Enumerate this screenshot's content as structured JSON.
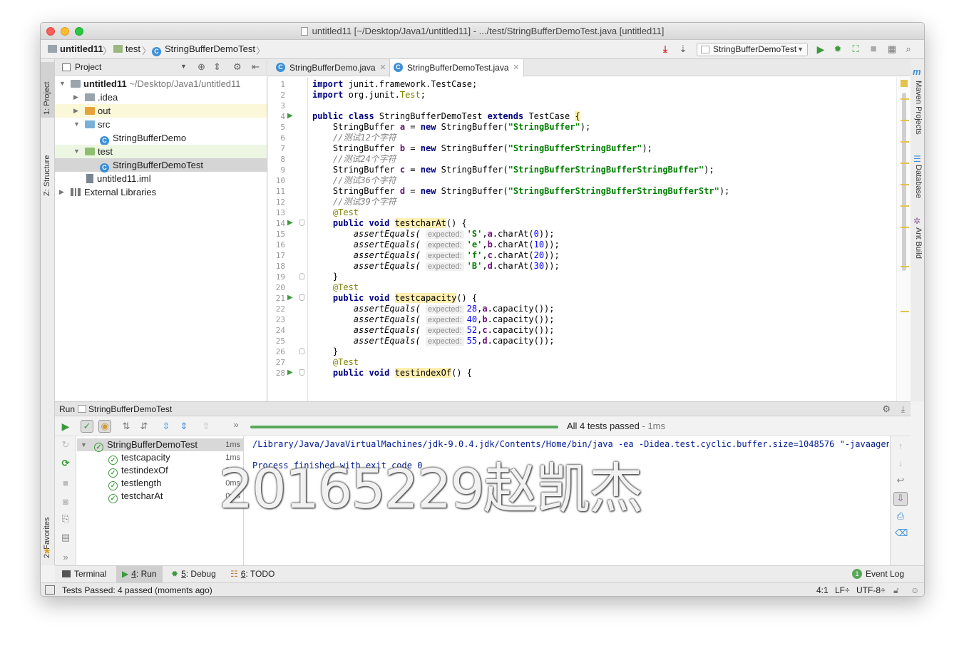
{
  "window": {
    "title": "untitled11 [~/Desktop/Java1/untitled11] - .../test/StringBufferDemoTest.java [untitled11]"
  },
  "breadcrumb": [
    "untitled11",
    "test",
    "StringBufferDemoTest"
  ],
  "toolbar": {
    "run_config": "StringBufferDemoTest"
  },
  "left_strip": {
    "project": "1: Project",
    "structure": "Z: Structure",
    "favorites": "2: Favorites"
  },
  "right_strip": {
    "maven": "Maven Projects",
    "database": "Database",
    "ant": "Ant Build"
  },
  "project_panel": {
    "title": "Project",
    "tree": [
      {
        "label": "untitled11",
        "extra": "~/Desktop/Java1/untitled11"
      },
      {
        "label": ".idea"
      },
      {
        "label": "out"
      },
      {
        "label": "src"
      },
      {
        "label": "StringBufferDemo"
      },
      {
        "label": "test"
      },
      {
        "label": "StringBufferDemoTest"
      },
      {
        "label": "untitled11.iml"
      },
      {
        "label": "External Libraries"
      }
    ]
  },
  "editor": {
    "tabs": [
      {
        "label": "StringBufferDemo.java",
        "active": false
      },
      {
        "label": "StringBufferDemoTest.java",
        "active": true
      }
    ],
    "hint": "expected:",
    "lines": {
      "l1a": "import",
      "l1b": " junit.framework.TestCase;",
      "l2a": "import",
      "l2b": " org.junit.",
      "l2c": "Test",
      "l2d": ";",
      "l4a": "public class",
      "l4b": " StringBufferDemoTest ",
      "l4c": "extends",
      "l4d": " TestCase ",
      "l4e": "{",
      "l5a": "    StringBuffer ",
      "l5b": "a",
      "l5c": " = ",
      "l5d": "new",
      "l5e": " StringBuffer(",
      "l5f": "\"StringBuffer\"",
      "l5g": ");",
      "l6": "    //测试12个字符",
      "l7a": "    StringBuffer ",
      "l7b": "b",
      "l7c": " = ",
      "l7d": "new",
      "l7e": " StringBuffer(",
      "l7f": "\"StringBufferStringBuffer\"",
      "l7g": ");",
      "l8": "    //测试24个字符",
      "l9a": "    StringBuffer ",
      "l9b": "c",
      "l9c": " = ",
      "l9d": "new",
      "l9e": " StringBuffer(",
      "l9f": "\"StringBufferStringBufferStringBuffer\"",
      "l9g": ");",
      "l10": "    //测试36个字符",
      "l11a": "    StringBuffer ",
      "l11b": "d",
      "l11c": " = ",
      "l11d": "new",
      "l11e": " StringBuffer(",
      "l11f": "\"StringBufferStringBufferStringBufferStr\"",
      "l11g": ");",
      "l12": "    //测试39个字符",
      "l13": "    @Test",
      "l14a": "    public void",
      "l14b": "testcharAt",
      "l14c": "() {",
      "l15a": "'S'",
      "l15b": "a",
      "l15c": ".charAt(",
      "l15d": "0",
      "l15e": "));",
      "l16a": "'e'",
      "l16b": "b",
      "l16c": ".charAt(",
      "l16d": "10",
      "l16e": "));",
      "l17a": "'f'",
      "l17b": "c",
      "l17c": ".charAt(",
      "l17d": "20",
      "l17e": "));",
      "l18a": "'B'",
      "l18b": "d",
      "l18c": ".charAt(",
      "l18d": "30",
      "l18e": "));",
      "l19": "    }",
      "l20": "    @Test",
      "l21a": "    public void",
      "l21b": "testcapacity",
      "l21c": "() {",
      "l22a": "28",
      "l22b": "a",
      "l22c": ".capacity());",
      "l23a": "40",
      "l23b": "b",
      "l23c": ".capacity());",
      "l24a": "52",
      "l24b": "c",
      "l24c": ".capacity());",
      "l25a": "55",
      "l25b": "d",
      "l25c": ".capacity());",
      "l26": "    }",
      "l27": "    @Test",
      "l28a": "    public void",
      "l28b": "testindexOf",
      "l28c": "() {",
      "assert": "        assertEquals( "
    }
  },
  "run_panel": {
    "tab_label": "Run",
    "config": "StringBufferDemoTest",
    "status": "All 4 tests passed",
    "status_time": " - 1ms",
    "tests": [
      {
        "name": "StringBufferDemoTest",
        "time": "1ms"
      },
      {
        "name": "testcapacity",
        "time": "1ms"
      },
      {
        "name": "testindexOf",
        "time": "0ms"
      },
      {
        "name": "testlength",
        "time": "0ms"
      },
      {
        "name": "testcharAt",
        "time": "0ms"
      }
    ],
    "console": [
      "/Library/Java/JavaVirtualMachines/jdk-9.0.4.jdk/Contents/Home/bin/java -ea -Didea.test.cyclic.buffer.size=1048576 \"-javaagent:/",
      "Process finished with exit code 0"
    ]
  },
  "watermark": "20165229赵凯杰",
  "bottom_tabs": {
    "terminal": "Terminal",
    "run_num": "4",
    "run": ": Run",
    "debug_num": "5",
    "debug": ": Debug",
    "todo_num": "6",
    "todo": ": TODO",
    "event_count": "1",
    "event_log": "Event Log"
  },
  "status_bar": {
    "message": "Tests Passed: 4 passed (moments ago)",
    "position": "4:1",
    "line_sep": "LF÷",
    "encoding": "UTF-8÷"
  },
  "colors": {
    "green": "#3c9a3c",
    "accent": "#3d8fd6",
    "progress": "#58a858"
  }
}
